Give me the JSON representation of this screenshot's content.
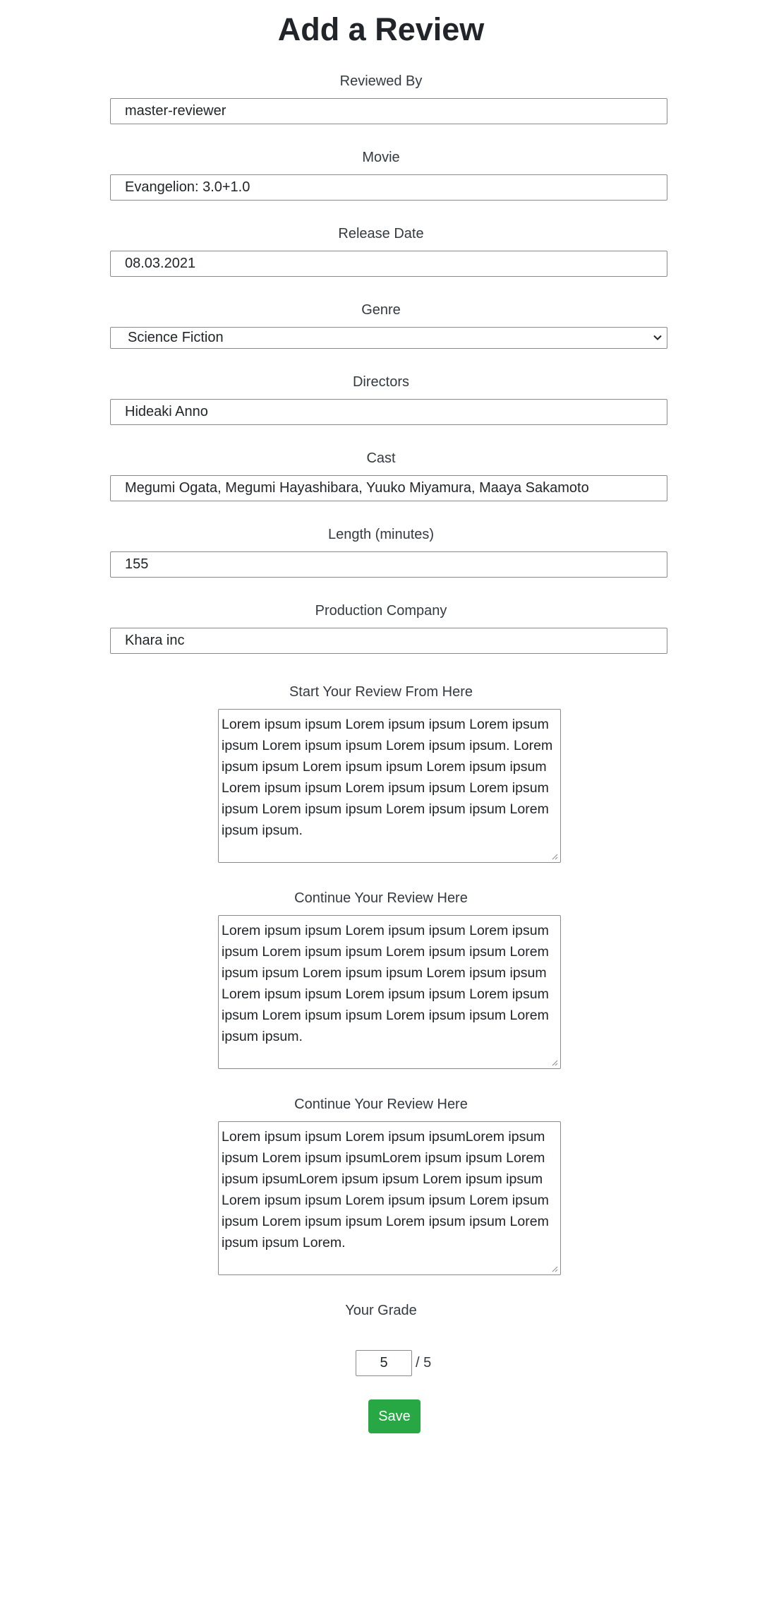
{
  "page": {
    "title": "Add a Review"
  },
  "form": {
    "reviewed_by": {
      "label": "Reviewed By",
      "value": "master-reviewer"
    },
    "movie": {
      "label": "Movie",
      "value": "Evangelion: 3.0+1.0"
    },
    "release_date": {
      "label": "Release Date",
      "value": "08.03.2021"
    },
    "genre": {
      "label": "Genre",
      "selected": "Science Fiction"
    },
    "directors": {
      "label": "Directors",
      "value": "Hideaki Anno"
    },
    "cast": {
      "label": "Cast",
      "value": "Megumi Ogata, Megumi Hayashibara, Yuuko Miyamura, Maaya Sakamoto"
    },
    "length": {
      "label": "Length (minutes)",
      "value": "155"
    },
    "production_company": {
      "label": "Production Company",
      "value": "Khara inc"
    },
    "review_start": {
      "label": "Start Your Review From Here",
      "value": "Lorem ipsum ipsum Lorem ipsum ipsum Lorem ipsum ipsum Lorem ipsum ipsum Lorem ipsum ipsum. Lorem ipsum ipsum Lorem ipsum ipsum Lorem ipsum ipsum Lorem ipsum ipsum Lorem ipsum ipsum Lorem ipsum ipsum Lorem ipsum ipsum Lorem ipsum ipsum Lorem ipsum ipsum."
    },
    "review_continue_1": {
      "label": "Continue Your Review Here",
      "value": "Lorem ipsum ipsum Lorem ipsum ipsum Lorem ipsum ipsum Lorem ipsum ipsum Lorem ipsum ipsum Lorem ipsum ipsum Lorem ipsum ipsum Lorem ipsum ipsum Lorem ipsum ipsum Lorem ipsum ipsum Lorem ipsum ipsum Lorem ipsum ipsum Lorem ipsum ipsum Lorem ipsum ipsum."
    },
    "review_continue_2": {
      "label": "Continue Your Review Here",
      "value": "Lorem ipsum ipsum Lorem ipsum ipsumLorem ipsum ipsum Lorem ipsum ipsumLorem ipsum ipsum Lorem ipsum ipsumLorem ipsum ipsum Lorem ipsum ipsum Lorem ipsum ipsum Lorem ipsum ipsum Lorem ipsum ipsum Lorem ipsum ipsum Lorem ipsum ipsum Lorem ipsum ipsum Lorem."
    },
    "grade": {
      "label": "Your Grade",
      "value": "5",
      "max_text": "/ 5"
    },
    "save_label": "Save"
  },
  "colors": {
    "save_button": "#28a745",
    "border": "#8a8a8a",
    "text": "#212529"
  },
  "icons": {
    "genre_dropdown": "chevron-down-icon",
    "textarea_resize": "resize-grip-icon"
  }
}
